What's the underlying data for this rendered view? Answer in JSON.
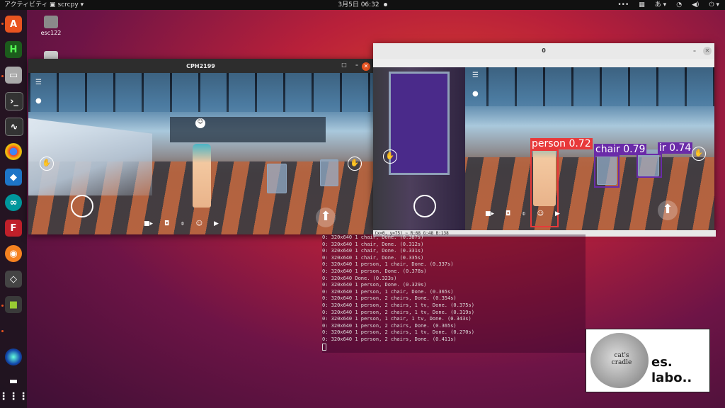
{
  "topbar": {
    "activities": "アクティビティ",
    "app_name": "scrcpy",
    "clock": "3月5日 06:32",
    "input_method": "あ"
  },
  "desktop": {
    "home_icon_label": "esc122"
  },
  "window_phone": {
    "title": "CPH2199"
  },
  "window_cv": {
    "title": "0",
    "status": "(x=0, y=75) ~ R:68 G:48 B:138",
    "detections": [
      {
        "label": "person 0.72",
        "color": "#e8393a"
      },
      {
        "label": "chair 0.79",
        "color": "#6a2ba8"
      },
      {
        "label": "ir 0.74",
        "color": "#6a2ba8"
      }
    ]
  },
  "terminal": {
    "lines": [
      "0: 320x640 1 chair, Done. (0.387s)",
      "0: 320x640 1 chair, Done. (0.312s)",
      "0: 320x640 1 chair, Done. (0.331s)",
      "0: 320x640 1 chair, Done. (0.335s)",
      "0: 320x640 1 person, 1 chair, Done. (0.337s)",
      "0: 320x640 1 person, Done. (0.378s)",
      "0: 320x640 Done. (0.323s)",
      "0: 320x640 1 person, Done. (0.329s)",
      "0: 320x640 1 person, 1 chair, Done. (0.365s)",
      "0: 320x640 1 person, 2 chairs, Done. (0.354s)",
      "0: 320x640 1 person, 2 chairs, 1 tv, Done. (0.375s)",
      "0: 320x640 1 person, 2 chairs, 1 tv, Done. (0.319s)",
      "0: 320x640 1 person, 1 chair, 1 tv, Done. (0.343s)",
      "0: 320x640 1 person, 2 chairs, Done. (0.365s)",
      "0: 320x640 1 person, 2 chairs, 1 tv, Done. (0.270s)",
      "0: 320x640 1 person, 2 chairs, Done. (0.411s)"
    ]
  },
  "logo": {
    "badge_line1": "cat's",
    "badge_line2": "cradle",
    "line1": "es.",
    "line2": "labo.."
  }
}
